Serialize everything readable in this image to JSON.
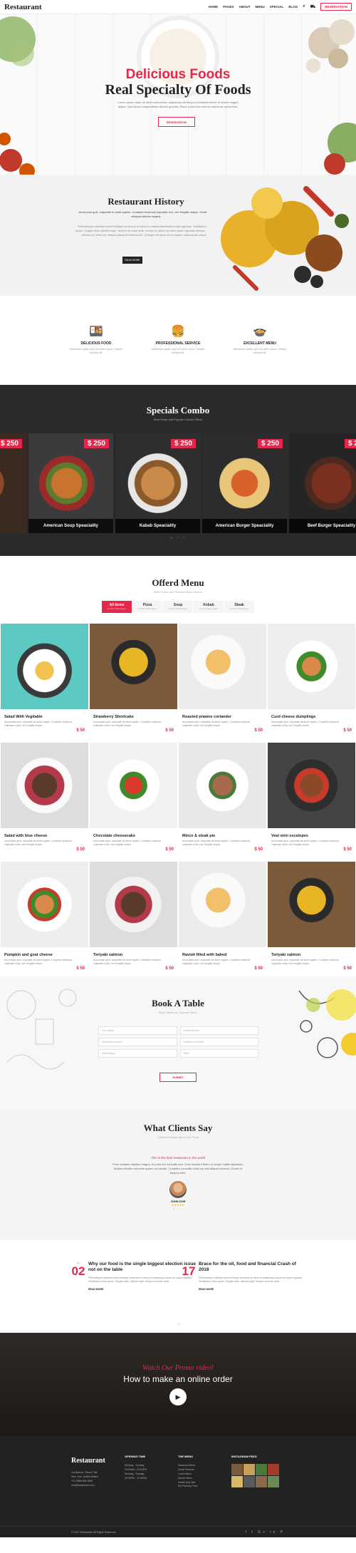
{
  "header": {
    "logo_text": "Restaurant",
    "nav": [
      "HOME",
      "PAGES",
      "ABOUT",
      "MENU",
      "SPECIAL",
      "BLOG"
    ],
    "reservation_label": "RESERVATION"
  },
  "hero": {
    "subtitle": "Delicious Foods",
    "title": "Real Specialty Of Foods",
    "text": "Lorem ipsum dolor sit amet consectetur adipiscing elit tempor incididunt labore et dolore magna aliqua. Quis ipsum suspendisse ultrices gravida. Risus commodo viverra maecenas accumsan.",
    "button": "RESERVATION"
  },
  "history": {
    "title": "Restaurant History",
    "lead": "Accumsan quis, vulputate et amet sapien. Curabitur euismod vulputate orci, nec fringilla neque. Vestibulum volutpat ultrices magna.",
    "body": "Pellentesque habitant morbi tristique senectus et netus et malesuada fames turpis egestas. Vestibulum tortor quam, feugiat vitae ultricies eget, tempor sit amet ante. Donec eu libero sit amet quam egestas semper. Aenean ultricies mi vitae est. Mauris placerat eleifend leo. Quisque sit amet est et sapien ullamcorper pharetra.",
    "button": "READ MORE"
  },
  "features": [
    {
      "icon": "food-icon",
      "title": "DELICIOUS FOOD",
      "text": "Maecenas sapien quis orci ante cursus. Ultrices volutpat elit."
    },
    {
      "icon": "service-icon",
      "title": "PROFESSIONAL SERVICE",
      "text": "Maecenas sapien quis orci ante cursus. Ultrices volutpat elit."
    },
    {
      "icon": "menu-icon",
      "title": "EXCELLENT MENU",
      "text": "Maecenas sapien quis orci ante cursus. Ultrices volutpat elit."
    }
  ],
  "specials": {
    "title": "Specials Combo",
    "subtitle": "Best Deals and Popular Combo Offers",
    "items": [
      {
        "name": "",
        "price": "$ 250"
      },
      {
        "name": "American Soup Speaciality",
        "price": "$ 250"
      },
      {
        "name": "Kabab Speaciality",
        "price": "$ 250"
      },
      {
        "name": "American Burger Speaciality",
        "price": "$ 250"
      },
      {
        "name": "Beef Burger Speaciality",
        "price": "$ 250"
      }
    ]
  },
  "menu": {
    "title": "Offerd Menu",
    "subtitle": "Best Foods and Popular Menu Dishes",
    "tabs": [
      {
        "label": "All Items",
        "sub": "Foods & Beverages"
      },
      {
        "label": "Pizza",
        "sub": "Foods & Beverages"
      },
      {
        "label": "Soup",
        "sub": "Foods & Beverages"
      },
      {
        "label": "Kebab",
        "sub": "Foods & Beverages"
      },
      {
        "label": "Steak",
        "sub": "Foods & Beverages"
      }
    ],
    "item_desc": "Accumsan quis, vulputate sit amet sapien. Curabitur euismod vulputate nulla, nec fringilla neque.",
    "items": [
      {
        "name": "Salad With Vegitable",
        "price": "$ 50"
      },
      {
        "name": "Strawberry Shortcake",
        "price": "$ 50"
      },
      {
        "name": "Roasted prawns coriander",
        "price": "$ 50"
      },
      {
        "name": "Curd cheese dumplings",
        "price": "$ 50"
      },
      {
        "name": "Salad with blue cheese",
        "price": "$ 50"
      },
      {
        "name": "Chocolate cheesecake",
        "price": "$ 50"
      },
      {
        "name": "Mince & steak pie",
        "price": "$ 50"
      },
      {
        "name": "Veal mini escalopes",
        "price": "$ 50"
      },
      {
        "name": "Pumpkin and goat cheese",
        "price": "$ 50"
      },
      {
        "name": "Teriyaki salmon",
        "price": "$ 50"
      },
      {
        "name": "Ravioli filled with baked",
        "price": "$ 50"
      },
      {
        "name": "Teriyaki salmon",
        "price": "$ 50"
      }
    ]
  },
  "book": {
    "title": "Book A Table",
    "subtitle": "Book Tables for Special Offers",
    "fields": [
      "Your Name",
      "Email Address",
      "Telephone number",
      "Number of Guests",
      "dd/mm/yyyy",
      "Time"
    ],
    "submit": "SUBMIT"
  },
  "clients": {
    "title": "What Clients Say",
    "subtitle": "Clients Reviews About Our Food",
    "headline": "This is the best restaurant in the world",
    "quote": "Proin sodales dapibus magna, et porta leo convallis sed. Cras tincidunt libero ut neque mattis dignissim. Nullam ultricies est amet quam non iaculis. Curabitur convallis nulla non nisl aliquet rhoncus. Donec ut tempus felis.",
    "name": "JOHN DOE",
    "stars": "★★★★★"
  },
  "blog": [
    {
      "month": "JAN",
      "day": "02",
      "title": "Why our food is the single biggest election issue not on the table",
      "text": "Pellentesque habitant morbi tristique senectus et netus et malesuada fames ac turpis egestas. Vestibulum tortor quam, feugiat vitae, ultricies eget, tempor sit amet, ante.",
      "more": "READ MORE"
    },
    {
      "month": "FEB",
      "day": "17",
      "title": "Brace for the oil, food and financial Crash of 2018",
      "text": "Pellentesque habitant morbi tristique senectus et netus et malesuada fames ac turpis egestas. Vestibulum tortor quam, feugiat vitae, ultricies eget, tempor sit amet, ante.",
      "more": "READ MORE"
    }
  ],
  "video": {
    "line1": "Watch Our Promo video!",
    "line2": "How to make an online order"
  },
  "footer": {
    "logo": "Restaurant",
    "address": [
      "1st Avenue, Street, Flat",
      "New York, United States",
      "+01 5555 654 5565",
      "info@restaurant.com"
    ],
    "opening_title": "OPENING TIME",
    "opening": [
      "Monday - Sunday",
      "09:00AM - 04:00PM",
      "Monday - Sunday",
      "06:00PM - 11:00PM"
    ],
    "menu_title": "THE MENU",
    "menu_links": [
      "Seasonal Items",
      "Small Portions",
      "Lunch Menu",
      "Dinner Items",
      "Health And Diet",
      "Kid Friendly Food"
    ],
    "insta_title": "INSTAGRAM FEED",
    "copyright": "© 2017 Restaurant, All Rights Reserved.",
    "social": "f t G+ in P"
  }
}
